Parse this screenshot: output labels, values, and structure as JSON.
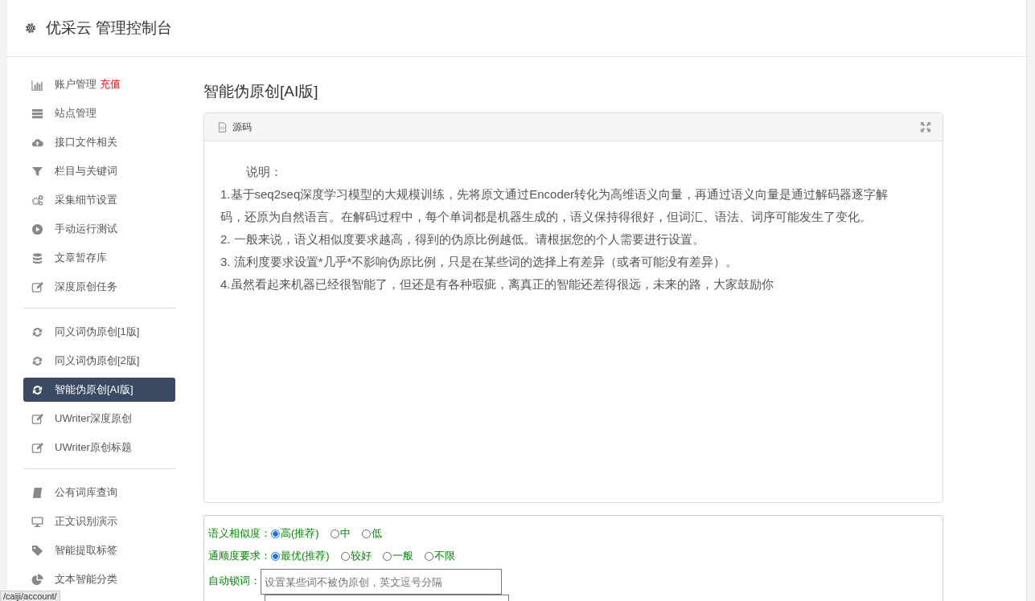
{
  "header": {
    "title": "优采云 管理控制台"
  },
  "sidebar": {
    "groups": [
      [
        {
          "label": "账户管理",
          "badge": "充值",
          "selected": false
        },
        {
          "label": "站点管理",
          "selected": false
        },
        {
          "label": "接口文件相关",
          "selected": false
        },
        {
          "label": "栏目与关键词",
          "selected": false
        },
        {
          "label": "采集细节设置",
          "selected": false
        },
        {
          "label": "手动运行测试",
          "selected": false
        },
        {
          "label": "文章暂存库",
          "selected": false
        },
        {
          "label": "深度原创任务",
          "selected": false
        }
      ],
      [
        {
          "label": "同义词伪原创[1版]",
          "selected": false
        },
        {
          "label": "同义词伪原创[2版]",
          "selected": false
        },
        {
          "label": "智能伪原创[AI版]",
          "selected": true
        },
        {
          "label": "UWriter深度原创",
          "selected": false
        },
        {
          "label": "UWriter原创标题",
          "selected": false
        }
      ],
      [
        {
          "label": "公有词库查询",
          "selected": false
        },
        {
          "label": "正文识别演示",
          "selected": false
        },
        {
          "label": "智能提取标签",
          "selected": false
        },
        {
          "label": "文本智能分类",
          "selected": false
        }
      ]
    ]
  },
  "page_title": "智能伪原创[AI版]",
  "editor": {
    "toolbar_label": "源码",
    "paragraphs": [
      {
        "kind": "heading",
        "text": "说明："
      },
      {
        "kind": "body",
        "text": "1.基于seq2seq深度学习模型的大规模训练，先将原文通过Encoder转化为高维语义向量，再通过语义向量是通过解码器逐字解码，还原为自然语言。在解码过程中，每个单词都是机器生成的，语义保持得很好，但词汇、语法、词序可能发生了变化。"
      },
      {
        "kind": "body",
        "text": "2. 一般来说，语义相似度要求越高，得到的伪原比例越低。请根据您的个人需要进行设置。"
      },
      {
        "kind": "body",
        "text": "3. 流利度要求设置*几乎*不影响伪原比例，只是在某些词的选择上有差异（或者可能没有差异）。"
      },
      {
        "kind": "body",
        "text": "4.虽然看起来机器已经很智能了，但还是有各种瑕疵，离真正的智能还差得很远，未来的路，大家鼓励你"
      }
    ]
  },
  "form": {
    "rows": [
      {
        "kind": "radio",
        "label": "语义相似度：",
        "options": [
          {
            "label": "高(推荐)",
            "selected": true
          },
          {
            "label": "中",
            "selected": false
          },
          {
            "label": "低",
            "selected": false
          }
        ]
      },
      {
        "kind": "radio",
        "label": "通顺度要求：",
        "options": [
          {
            "label": "最优(推荐)",
            "selected": true
          },
          {
            "label": "较好",
            "selected": false
          },
          {
            "label": "一般",
            "selected": false
          },
          {
            "label": "不限",
            "selected": false
          }
        ]
      },
      {
        "kind": "field",
        "label": "自动锁词：",
        "placeholder": "设置某些词不被伪原创，英文逗号分隔"
      },
      {
        "kind": "textarea"
      }
    ]
  },
  "status_url": "/caiji/account/"
}
